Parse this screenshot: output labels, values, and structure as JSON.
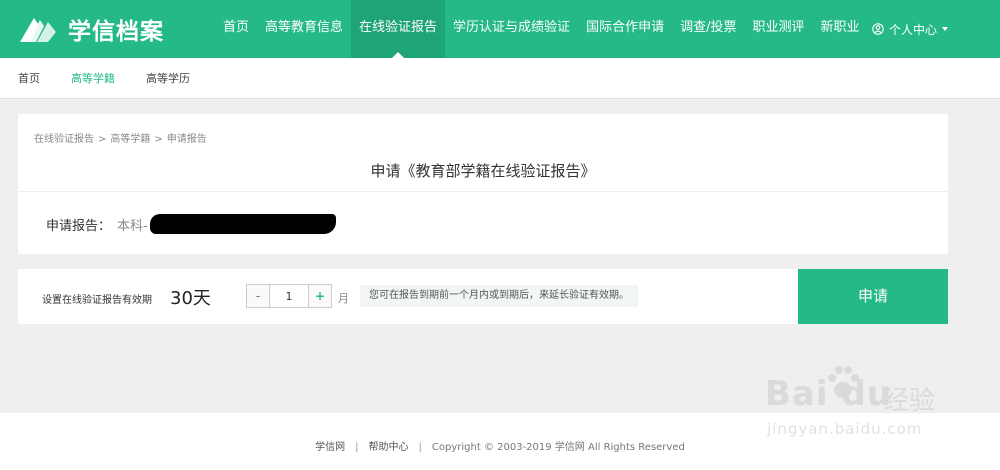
{
  "brand": {
    "name": "学信档案"
  },
  "nav": {
    "items": [
      {
        "label": "首页",
        "active": false
      },
      {
        "label": "高等教育信息",
        "active": false
      },
      {
        "label": "在线验证报告",
        "active": true
      },
      {
        "label": "学历认证与成绩验证",
        "active": false
      },
      {
        "label": "国际合作申请",
        "active": false
      },
      {
        "label": "调查/投票",
        "active": false
      },
      {
        "label": "职业测评",
        "active": false
      },
      {
        "label": "新职业",
        "active": false
      }
    ],
    "user_menu": "个人中心"
  },
  "subnav": {
    "items": [
      {
        "label": "首页",
        "active": false
      },
      {
        "label": "高等学籍",
        "active": true
      },
      {
        "label": "高等学历",
        "active": false
      }
    ]
  },
  "breadcrumb": [
    "在线验证报告",
    "高等学籍",
    "申请报告"
  ],
  "apply": {
    "title": "申请《教育部学籍在线验证报告》",
    "report_label": "申请报告：",
    "report_value": "本科-"
  },
  "validity": {
    "label": "设置在线验证报告有效期",
    "days": "30天",
    "minus": "-",
    "plus": "+",
    "months_value": "1",
    "unit": "月",
    "tip": "您可在报告到期前一个月内或到期后，来延长验证有效期。",
    "apply_button": "申请"
  },
  "footer": {
    "links": [
      "学信网",
      "帮助中心"
    ],
    "copyright": "Copyright © 2003-2019 学信网 All Rights Reserved"
  },
  "watermark": {
    "logo": "Bai du",
    "cn": "经验",
    "url": "jingyan.baidu.com"
  },
  "colors": {
    "primary": "#25b988",
    "primary_dark": "#1fa478",
    "background": "#efefef"
  }
}
